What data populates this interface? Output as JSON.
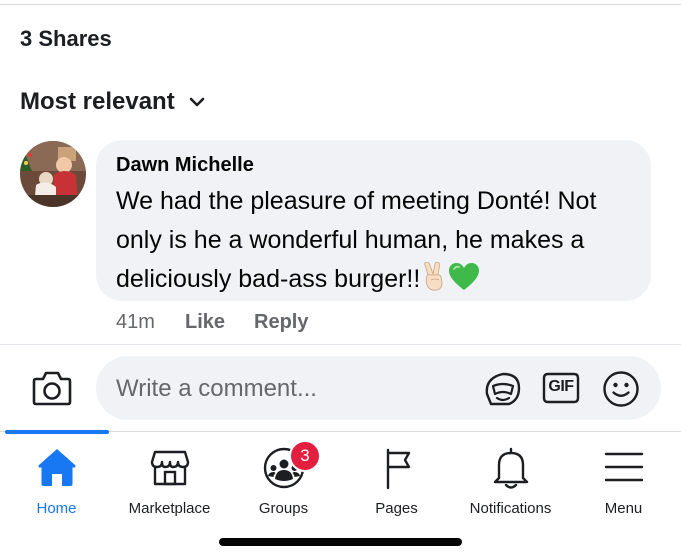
{
  "post": {
    "shares_text": "3 Shares"
  },
  "comments": {
    "sort_label": "Most relevant",
    "items": [
      {
        "author": "Dawn Michelle",
        "text": "We had the pleasure of meeting Donté! Not only is he a wonderful human, he makes a deliciously bad-ass burger!!",
        "emojis": [
          "victory-hand",
          "green-heart"
        ],
        "time": "41m",
        "like_label": "Like",
        "reply_label": "Reply"
      }
    ]
  },
  "composer": {
    "placeholder": "Write a comment...",
    "gif_label": "GIF"
  },
  "tabbar": {
    "items": [
      {
        "label": "Home",
        "icon": "home-icon",
        "active": true
      },
      {
        "label": "Marketplace",
        "icon": "marketplace-icon"
      },
      {
        "label": "Groups",
        "icon": "groups-icon",
        "badge": "3"
      },
      {
        "label": "Pages",
        "icon": "flag-icon"
      },
      {
        "label": "Notifications",
        "icon": "bell-icon"
      },
      {
        "label": "Menu",
        "icon": "hamburger-icon"
      }
    ]
  },
  "colors": {
    "accent": "#1877f2",
    "badge": "#e41e3f",
    "bubble": "#f0f2f5",
    "secondary_text": "#65676b"
  }
}
